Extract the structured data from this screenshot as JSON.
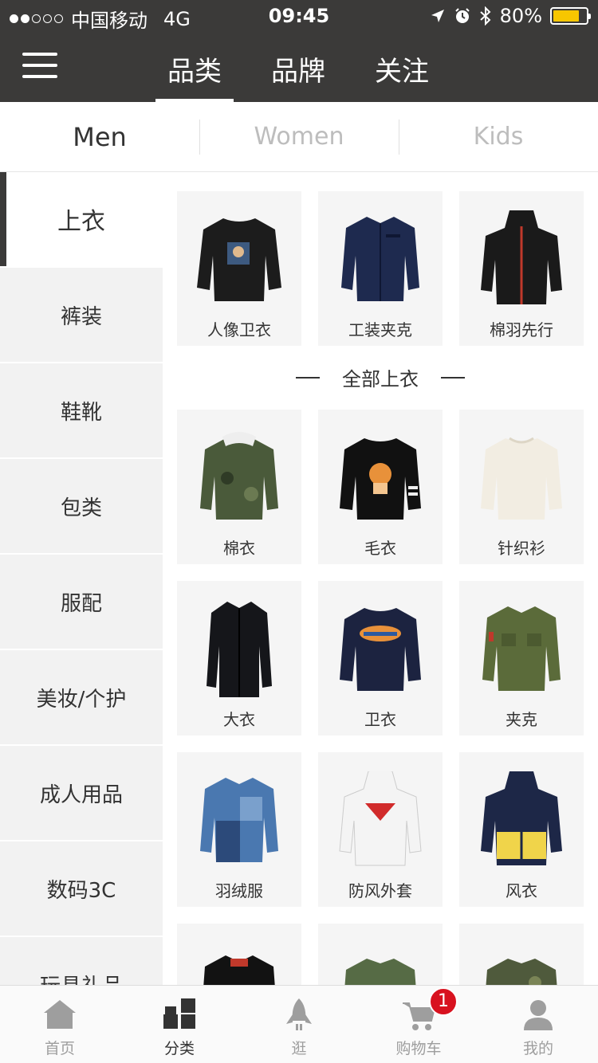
{
  "status_bar": {
    "carrier": "中国移动",
    "network": "4G",
    "time": "09:45",
    "battery_text": "80%",
    "battery_level": 0.8
  },
  "top_nav": {
    "tabs": [
      {
        "label": "品类",
        "active": true
      },
      {
        "label": "品牌",
        "active": false
      },
      {
        "label": "关注",
        "active": false
      }
    ]
  },
  "gender_tabs": [
    {
      "label": "Men",
      "active": true
    },
    {
      "label": "Women",
      "active": false
    },
    {
      "label": "Kids",
      "active": false
    }
  ],
  "sidebar": {
    "items": [
      {
        "label": "上衣",
        "active": true
      },
      {
        "label": "裤装"
      },
      {
        "label": "鞋靴"
      },
      {
        "label": "包类"
      },
      {
        "label": "服配"
      },
      {
        "label": "美妆/个护"
      },
      {
        "label": "成人用品"
      },
      {
        "label": "数码3C"
      },
      {
        "label": "玩具礼品"
      }
    ]
  },
  "featured": [
    {
      "label": "人像卫衣",
      "icon": "sweatshirt-portrait-icon"
    },
    {
      "label": "工装夹克",
      "icon": "work-jacket-icon"
    },
    {
      "label": "棉羽先行",
      "icon": "hooded-jacket-icon"
    }
  ],
  "section_title": "全部上衣",
  "categories": [
    {
      "label": "棉衣",
      "icon": "padded-coat-icon"
    },
    {
      "label": "毛衣",
      "icon": "sweater-icon"
    },
    {
      "label": "针织衫",
      "icon": "knitwear-icon"
    },
    {
      "label": "大衣",
      "icon": "overcoat-icon"
    },
    {
      "label": "卫衣",
      "icon": "sweatshirt-icon"
    },
    {
      "label": "夹克",
      "icon": "jacket-icon"
    },
    {
      "label": "羽绒服",
      "icon": "down-jacket-icon"
    },
    {
      "label": "防风外套",
      "icon": "windbreaker-icon"
    },
    {
      "label": "风衣",
      "icon": "trench-icon"
    },
    {
      "label": "",
      "icon": "leather-jacket-icon"
    },
    {
      "label": "",
      "icon": "field-jacket-icon"
    },
    {
      "label": "",
      "icon": "camo-jacket-icon"
    }
  ],
  "tab_bar": {
    "items": [
      {
        "label": "首页",
        "icon": "home-icon"
      },
      {
        "label": "分类",
        "icon": "category-icon",
        "active": true
      },
      {
        "label": "逛",
        "icon": "rocket-icon"
      },
      {
        "label": "购物车",
        "icon": "cart-icon",
        "badge": "1"
      },
      {
        "label": "我的",
        "icon": "user-icon"
      }
    ]
  },
  "colors": {
    "header_bg": "#3b3a39",
    "sidebar_bg": "#f2f2f2",
    "card_bg": "#f5f5f5",
    "badge_red": "#d8121f",
    "battery_yellow": "#f7c600"
  }
}
